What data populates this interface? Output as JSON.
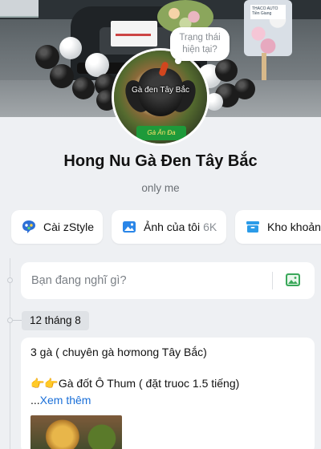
{
  "cover": {
    "stand_sign_text": "THACO AUTO Tiền Giang"
  },
  "avatar": {
    "caption": "Gà đen Tây Bắc",
    "box_label": "Gà Ăn Đa"
  },
  "status_bubble": {
    "line1": "Trạng thái",
    "line2": "hiện tại?"
  },
  "profile": {
    "name": "Hong Nu Gà Đen Tây Bắc",
    "visibility": "only me"
  },
  "actions": [
    {
      "label": "Cài zStyle",
      "count": "",
      "icon": "zstyle-icon"
    },
    {
      "label": "Ảnh của tôi",
      "count": "6K",
      "icon": "photo-icon"
    },
    {
      "label": "Kho khoảnh",
      "count": "",
      "icon": "archive-icon"
    }
  ],
  "composer": {
    "placeholder": "Bạn đang nghĩ gì?"
  },
  "timeline": {
    "date": "12 tháng 8"
  },
  "post": {
    "line1": "3 gà ( chuyên gà hơmong Tây Bắc)",
    "line2": "👉👉Gà đốt Ô Thum ( đặt truoc 1.5 tiếng)",
    "ellipsis": "...",
    "see_more": "Xem thêm"
  },
  "colors": {
    "background": "#eef0f3",
    "link": "#1a6fd8",
    "zstyle_blue": "#2c6fd6",
    "photo_blue": "#2a86e8",
    "archive_blue": "#2b9be8",
    "composer_photo_green": "#3aa85a"
  }
}
